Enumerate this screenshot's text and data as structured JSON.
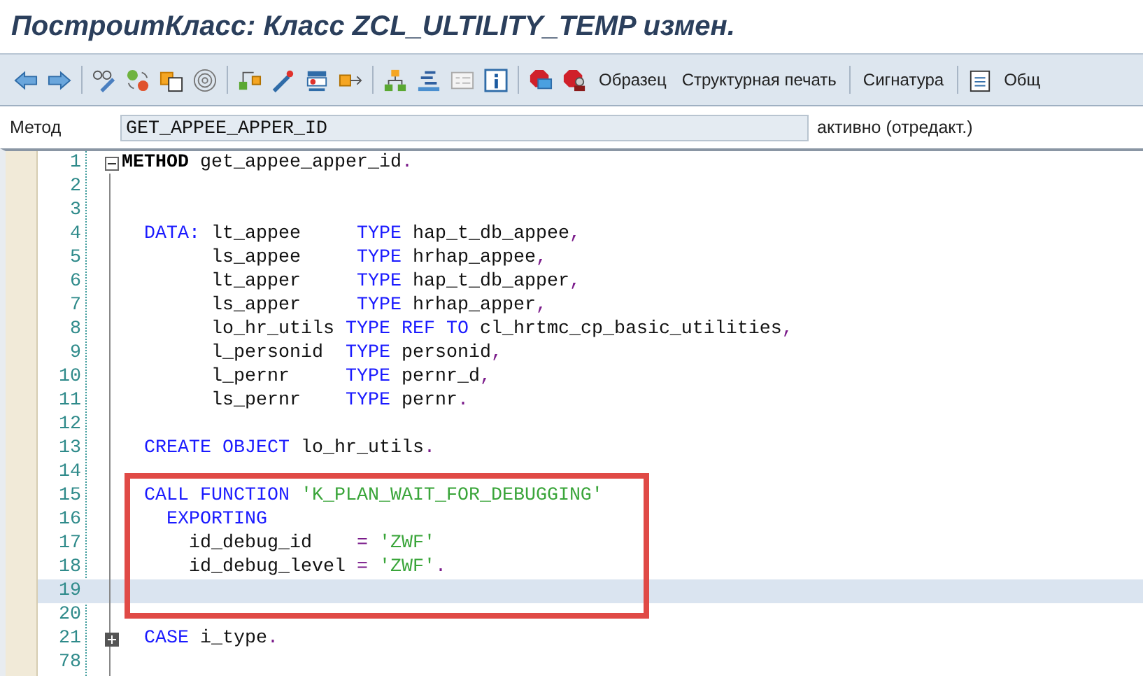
{
  "window": {
    "title": "ПостроитКласс: Класс ZCL_ULTILITY_TEMP измен."
  },
  "toolbar": {
    "buttons": [
      "Образец",
      "Структурная печать",
      "Сигнатура",
      "Общ"
    ]
  },
  "method_field": {
    "label": "Метод",
    "value": "GET_APPEE_APPER_ID",
    "status": "активно (отредакт.)"
  },
  "editor": {
    "lines": [
      {
        "number": "1",
        "expanded": true,
        "tokens": [
          {
            "kind": "bold",
            "text": "METHOD"
          },
          {
            "kind": "ident",
            "text": " get_appee_apper_id"
          },
          {
            "kind": "punct",
            "text": "."
          }
        ]
      },
      {
        "number": "2"
      },
      {
        "number": "3"
      },
      {
        "number": "4",
        "tokens": [
          {
            "kind": "keyword",
            "text": "  DATA:"
          },
          {
            "kind": "ident",
            "text": " lt_appee     "
          },
          {
            "kind": "keyword",
            "text": "TYPE"
          },
          {
            "kind": "ident",
            "text": " hap_t_db_appee"
          },
          {
            "kind": "punct",
            "text": ","
          }
        ]
      },
      {
        "number": "5",
        "tokens": [
          {
            "kind": "ident",
            "text": "        ls_appee     "
          },
          {
            "kind": "keyword",
            "text": "TYPE"
          },
          {
            "kind": "ident",
            "text": " hrhap_appee"
          },
          {
            "kind": "punct",
            "text": ","
          }
        ]
      },
      {
        "number": "6",
        "tokens": [
          {
            "kind": "ident",
            "text": "        lt_apper     "
          },
          {
            "kind": "keyword",
            "text": "TYPE"
          },
          {
            "kind": "ident",
            "text": " hap_t_db_apper"
          },
          {
            "kind": "punct",
            "text": ","
          }
        ]
      },
      {
        "number": "7",
        "tokens": [
          {
            "kind": "ident",
            "text": "        ls_apper     "
          },
          {
            "kind": "keyword",
            "text": "TYPE"
          },
          {
            "kind": "ident",
            "text": " hrhap_apper"
          },
          {
            "kind": "punct",
            "text": ","
          }
        ]
      },
      {
        "number": "8",
        "tokens": [
          {
            "kind": "ident",
            "text": "        lo_hr_utils "
          },
          {
            "kind": "keyword",
            "text": "TYPE REF TO"
          },
          {
            "kind": "ident",
            "text": " cl_hrtmc_cp_basic_utilities"
          },
          {
            "kind": "punct",
            "text": ","
          }
        ]
      },
      {
        "number": "9",
        "tokens": [
          {
            "kind": "ident",
            "text": "        l_personid  "
          },
          {
            "kind": "keyword",
            "text": "TYPE"
          },
          {
            "kind": "ident",
            "text": " personid"
          },
          {
            "kind": "punct",
            "text": ","
          }
        ]
      },
      {
        "number": "10",
        "tokens": [
          {
            "kind": "ident",
            "text": "        l_pernr     "
          },
          {
            "kind": "keyword",
            "text": "TYPE"
          },
          {
            "kind": "ident",
            "text": " pernr_d"
          },
          {
            "kind": "punct",
            "text": ","
          }
        ]
      },
      {
        "number": "11",
        "tokens": [
          {
            "kind": "ident",
            "text": "        ls_pernr    "
          },
          {
            "kind": "keyword",
            "text": "TYPE"
          },
          {
            "kind": "ident",
            "text": " pernr"
          },
          {
            "kind": "punct",
            "text": "."
          }
        ]
      },
      {
        "number": "12"
      },
      {
        "number": "13",
        "tokens": [
          {
            "kind": "keyword",
            "text": "  CREATE OBJECT"
          },
          {
            "kind": "ident",
            "text": " lo_hr_utils"
          },
          {
            "kind": "punct",
            "text": "."
          }
        ]
      },
      {
        "number": "14"
      },
      {
        "number": "15",
        "framed": true,
        "tokens": [
          {
            "kind": "keyword",
            "text": "  CALL FUNCTION"
          },
          {
            "kind": "string",
            "text": " 'K_PLAN_WAIT_FOR_DEBUGGING'"
          }
        ]
      },
      {
        "number": "16",
        "framed": true,
        "tokens": [
          {
            "kind": "keyword",
            "text": "    EXPORTING"
          }
        ]
      },
      {
        "number": "17",
        "framed": true,
        "tokens": [
          {
            "kind": "ident",
            "text": "      id_debug_id    "
          },
          {
            "kind": "punct",
            "text": "="
          },
          {
            "kind": "string",
            "text": " 'ZWF'"
          }
        ]
      },
      {
        "number": "18",
        "framed": true,
        "tokens": [
          {
            "kind": "ident",
            "text": "      id_debug_level "
          },
          {
            "kind": "punct",
            "text": "="
          },
          {
            "kind": "string",
            "text": " 'ZWF'"
          },
          {
            "kind": "punct",
            "text": "."
          }
        ]
      },
      {
        "number": "19",
        "current": true,
        "framed": true
      },
      {
        "number": "20"
      },
      {
        "number": "21",
        "expanded": false,
        "tokens": [
          {
            "kind": "keyword",
            "text": "  CASE"
          },
          {
            "kind": "ident",
            "text": " i_type"
          },
          {
            "kind": "punct",
            "text": "."
          }
        ]
      },
      {
        "number": "78"
      }
    ]
  }
}
